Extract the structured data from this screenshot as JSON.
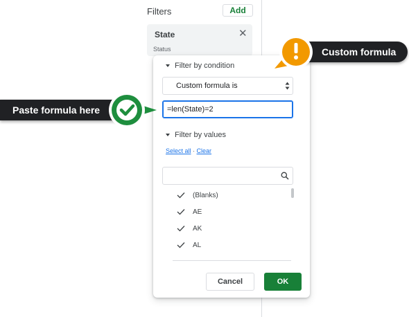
{
  "sidebar": {
    "title": "Filters",
    "add_label": "Add",
    "filter_card": {
      "title": "State",
      "sub": "Status"
    }
  },
  "panel": {
    "condition_header": "Filter by condition",
    "condition_select": "Custom formula is",
    "formula_value": "=len(State)=2",
    "values_header": "Filter by values",
    "select_all": "Select all",
    "separator": " · ",
    "clear": "Clear",
    "values": [
      "(Blanks)",
      "AE",
      "AK",
      "AL"
    ],
    "cancel_label": "Cancel",
    "ok_label": "OK"
  },
  "callouts": {
    "custom_formula": "Custom formula",
    "paste_formula": "Paste formula here"
  },
  "colors": {
    "brand_green": "#188038",
    "callout_bg": "#202124",
    "warning_orange": "#f29900",
    "check_green": "#1e8e3e",
    "focus_blue": "#1a73e8"
  },
  "icons": {
    "add": "none",
    "close": "close-icon",
    "caret": "caret-down-icon",
    "select_arrows": "updown-arrows-icon",
    "search": "search-icon",
    "check": "check-icon",
    "warning": "exclamation-icon",
    "success": "checkmark-circle-icon"
  }
}
